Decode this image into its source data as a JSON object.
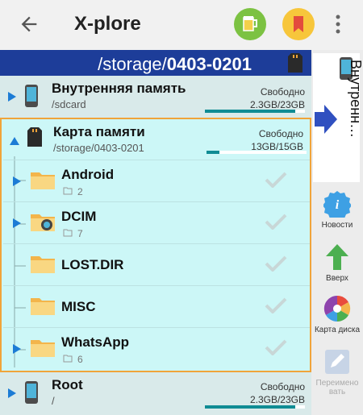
{
  "appbar": {
    "title": "X-plore"
  },
  "pathbar": {
    "prefix": "/storage/",
    "bold": "0403-0201"
  },
  "volumes": [
    {
      "name": "Внутренняя память",
      "path": "/sdcard",
      "free_label": "Свободно",
      "free": "2.3GB/23GB",
      "usage": 0.9
    },
    {
      "name": "Карта памяти",
      "path": "/storage/0403-0201",
      "free_label": "Свободно",
      "free": "13GB/15GB",
      "usage": 0.13
    },
    {
      "name": "Root",
      "path": "/",
      "free_label": "Свободно",
      "free": "2.3GB/23GB",
      "usage": 0.9
    }
  ],
  "folders": [
    {
      "name": "Android",
      "count": "2"
    },
    {
      "name": "DCIM",
      "count": "7"
    },
    {
      "name": "LOST.DIR",
      "count": ""
    },
    {
      "name": "MISC",
      "count": ""
    },
    {
      "name": "WhatsApp",
      "count": "6"
    }
  ],
  "right_panel": {
    "tab_label": "Внутренн…",
    "tools": [
      {
        "label": "Новости"
      },
      {
        "label": "Вверх"
      },
      {
        "label": "Карта диска"
      },
      {
        "label": "Переимено вать"
      }
    ]
  }
}
